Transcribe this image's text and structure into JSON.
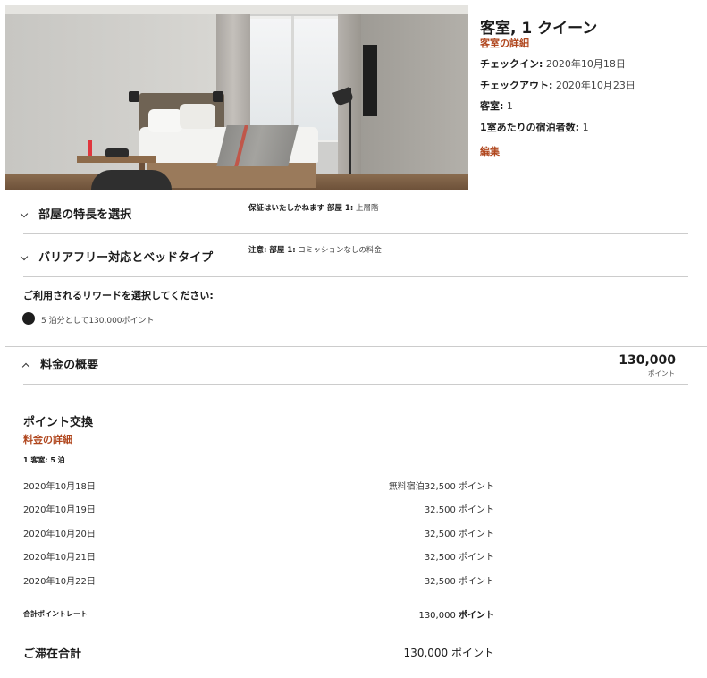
{
  "room": {
    "title": "客室, 1 クイーン",
    "details_link": "客室の詳細",
    "checkin_label": "チェックイン:",
    "checkin_value": "2020年10月18日",
    "checkout_label": "チェックアウト:",
    "checkout_value": "2020年10月23日",
    "rooms_label": "客室:",
    "rooms_value": "1",
    "guests_label": "1室あたりの宿泊者数:",
    "guests_value": "1",
    "edit_link": "編集"
  },
  "accordion": [
    {
      "label": "部屋の特長を選択",
      "note_bold": "保証はいたしかねます 部屋 1:",
      "note_text": "上層階"
    },
    {
      "label": "バリアフリー対応とベッドタイプ",
      "note_bold": "注意: 部屋 1:",
      "note_text": "コミッションなしの料金"
    }
  ],
  "rewards": {
    "question": "ご利用されるリワードを選択してください:",
    "option_label": "5 泊分として130,000ポイント"
  },
  "summary": {
    "label": "料金の概要",
    "total_points": "130,000",
    "unit": "ポイント"
  },
  "points_exchange": {
    "title": "ポイント交換",
    "details_link": "料金の詳細",
    "stay_info": "1 客室: 5 泊",
    "nights": [
      {
        "date": "2020年10月18日",
        "prefix": "無料宿泊",
        "struck": "32,500",
        "value": "",
        "unit": "ポイント"
      },
      {
        "date": "2020年10月19日",
        "prefix": "",
        "struck": "",
        "value": "32,500",
        "unit": "ポイント"
      },
      {
        "date": "2020年10月20日",
        "prefix": "",
        "struck": "",
        "value": "32,500",
        "unit": "ポイント"
      },
      {
        "date": "2020年10月21日",
        "prefix": "",
        "struck": "",
        "value": "32,500",
        "unit": "ポイント"
      },
      {
        "date": "2020年10月22日",
        "prefix": "",
        "struck": "",
        "value": "32,500",
        "unit": "ポイント"
      }
    ],
    "total_rate_label": "合計ポイントレート",
    "total_rate_value": "130,000",
    "total_rate_unit": "ポイント",
    "grand_total_label": "ご滞在合計",
    "grand_total_value": "130,000 ポイント"
  },
  "colors": {
    "link": "#b0461d",
    "text": "#1c1c1c",
    "divider": "#cccccc"
  },
  "icons": [
    "chevron-down-icon",
    "chevron-down-icon",
    "chevron-up-icon",
    "radio-selected-icon"
  ]
}
